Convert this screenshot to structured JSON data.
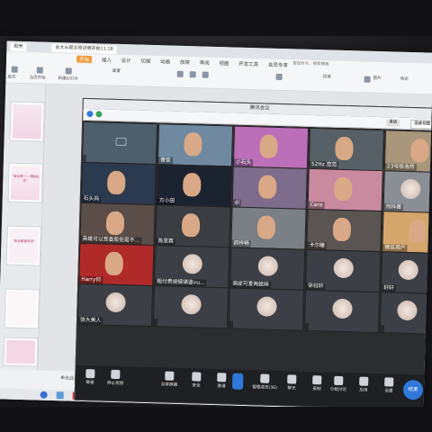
{
  "wps": {
    "tabs": [
      "稻壳",
      "长大从帮文母访明开始11.18"
    ],
    "menu": [
      "开始",
      "插入",
      "设计",
      "切换",
      "动画",
      "放映",
      "审阅",
      "视图",
      "开发工具",
      "会员专享"
    ],
    "search_text": "查找命令、搜索模板",
    "toolbar_labels": [
      "版式",
      "当页开始",
      "新建幻灯片",
      "重置",
      "段落",
      "图片",
      "填充"
    ],
    "status_text": "单击此处添加备注",
    "thumbnail_texts": [
      "“安全第一，预防在先”",
      "“安全教育知识”"
    ]
  },
  "meeting": {
    "title": "腾讯会议",
    "speaking_badge": "讲话",
    "view_label": "画廊视图",
    "participants": [
      [
        "",
        "善莹",
        "小石头",
        "52Hz 范范",
        "23号张浩然"
      ],
      [
        "石头妈",
        "方小田",
        "dl",
        "Cara",
        "何梓墨"
      ],
      [
        "英雄可以受委屈但是不...",
        "陈思霖",
        "郝梓畅",
        "卡尔瞳",
        "微信用户"
      ],
      [
        "Harry何",
        "粗付费按摸镇鉴vu...",
        "调皮可爱两姐妹",
        "徐钰轩",
        "轩轩"
      ],
      [
        "张大美人",
        "",
        "",
        "",
        ""
      ]
    ],
    "controls": [
      "静音",
      "停止视频",
      "共享屏幕",
      "安全",
      "邀请",
      "管理成员(36)",
      "聊天",
      "录制",
      "分组讨论",
      "应用",
      "设置"
    ],
    "leave_label": "结束"
  },
  "colors": {
    "meeting_bg": "#2c2d31",
    "accent": "#2f78d9",
    "wps_orange": "#f19a38"
  }
}
